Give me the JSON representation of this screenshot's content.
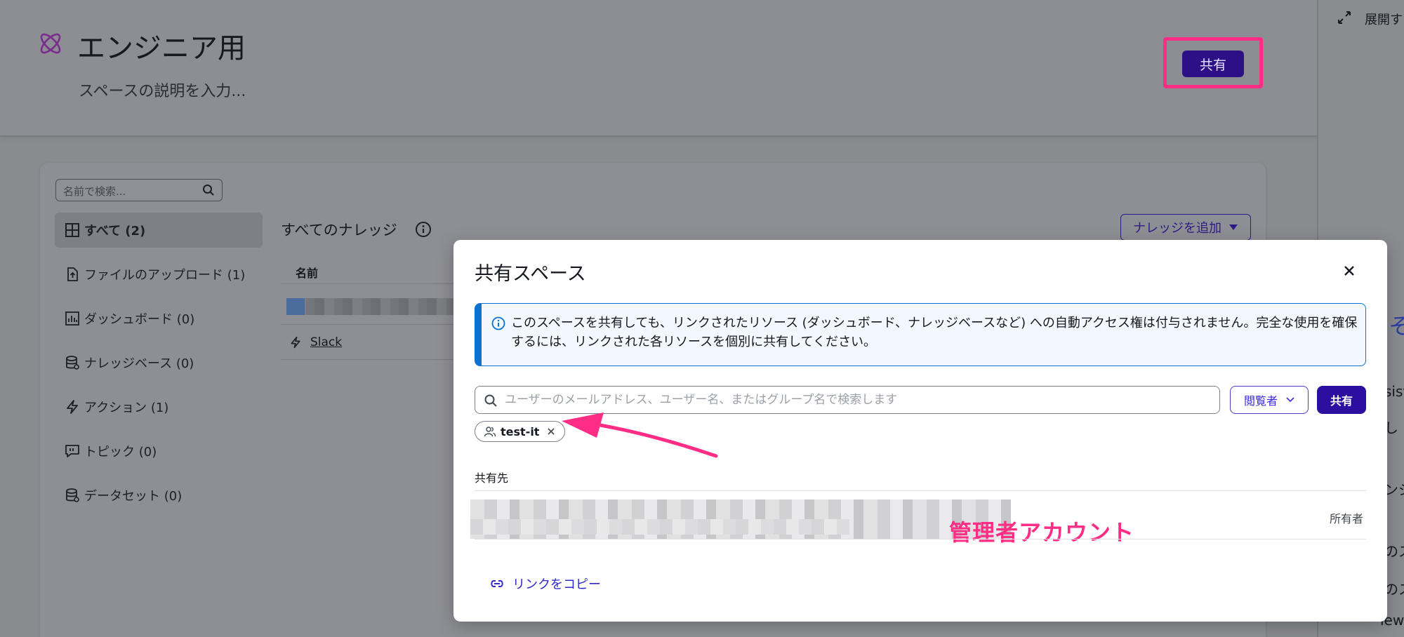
{
  "header": {
    "title": "エンジニア用",
    "description": "スペースの説明を入力...",
    "share_label": "共有"
  },
  "right_panel": {
    "expand_label": "展開す",
    "edge_glyphs": [
      "そ",
      "sist",
      "し",
      "ンジ",
      "のス",
      "のス",
      "iew r"
    ]
  },
  "sidebar": {
    "search_placeholder": "名前で検索...",
    "items": [
      {
        "label": "すべて (2)",
        "icon": "grid-icon"
      },
      {
        "label": "ファイルのアップロード (1)",
        "icon": "file-upload-icon"
      },
      {
        "label": "ダッシュボード (0)",
        "icon": "dashboard-icon"
      },
      {
        "label": "ナレッジベース (0)",
        "icon": "database-icon"
      },
      {
        "label": "アクション (1)",
        "icon": "lightning-icon"
      },
      {
        "label": "トピック (0)",
        "icon": "chat-icon"
      },
      {
        "label": "データセット (0)",
        "icon": "database-icon"
      }
    ]
  },
  "main": {
    "section_title": "すべてのナレッジ",
    "add_label": "ナレッジを追加",
    "column_name": "名前",
    "rows": [
      {
        "name": "Slack",
        "icon": "lightning-icon"
      }
    ]
  },
  "modal": {
    "title": "共有スペース",
    "alert_text": "このスペースを共有しても、リンクされたリソース (ダッシュボード、ナレッジベースなど) への自動アクセス権は付与されません。完全な使用を確保するには、リンクされた各リソースを個別に共有してください。",
    "search_placeholder": "ユーザーのメールアドレス、ユーザー名、またはグループ名で検索します",
    "search_value": "",
    "role_value": "閲覧者",
    "share_label": "共有",
    "token_label": "test-it",
    "shared_with_label": "共有先",
    "owner_role": "所有者",
    "copy_link_label": "リンクをコピー"
  },
  "annotations": {
    "admin_label": "管理者アカウント",
    "highlight_color": "#ff2d86"
  }
}
